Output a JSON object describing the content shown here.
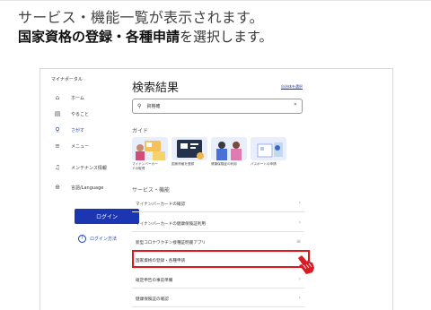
{
  "caption": {
    "line1": "サービス・機能一覧が表示されます。",
    "line2_bold": "国家資格の登録・各種申請",
    "line2_rest": "を選択します。"
  },
  "app": {
    "brand": "マイナポータル",
    "nav": [
      {
        "icon": "home-icon",
        "label": "ホーム"
      },
      {
        "icon": "todo-icon",
        "label": "やること"
      },
      {
        "icon": "search-icon",
        "label": "さがす"
      },
      {
        "icon": "menu-icon",
        "label": "メニュー"
      },
      {
        "icon": "bell-icon",
        "label": "メンテナンス情報"
      },
      {
        "icon": "globe-icon",
        "label": "言語/Language"
      }
    ],
    "login_label": "ログイン",
    "help_label": "ログイン方法"
  },
  "main": {
    "title": "検索結果",
    "top_link": "自治体を選択",
    "search": {
      "value": "資格確"
    },
    "guide_label": "ガイド",
    "guides": [
      {
        "caption1": "マイナンバーカー",
        "caption2": "ドの取得"
      },
      {
        "caption1": "国家資格を登録",
        "caption2": ""
      },
      {
        "caption1": "健康保険証の利用",
        "caption2": ""
      },
      {
        "caption1": "パスポートの申請",
        "caption2": ""
      }
    ],
    "services_label": "サービス・機能",
    "services": [
      {
        "label": "マイナンバーカードの確認",
        "icon": "chevron-right-icon"
      },
      {
        "label": "マイナンバーカードの健康保険証利用",
        "icon": "chevron-right-icon"
      },
      {
        "label": "新型コロナワクチン接種証明書アプリ",
        "icon": "menu-icon"
      },
      {
        "label": "国家資格の登録・各種申請",
        "icon": "chevron-right-icon"
      },
      {
        "label": "確定申告の事前準備",
        "icon": "chevron-right-icon"
      },
      {
        "label": "健康保険証の確認",
        "icon": "chevron-right-icon"
      }
    ]
  },
  "colors": {
    "accent": "#1c35b0",
    "highlight": "#e0161c"
  }
}
